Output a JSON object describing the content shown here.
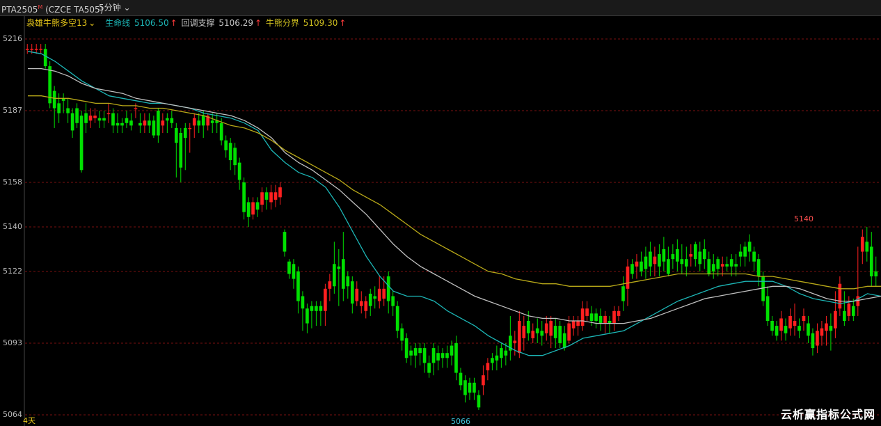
{
  "header": {
    "symbol": "PTA2505",
    "symbol_mark": "M",
    "code": "(CZCE TA505)",
    "period": "5分钟",
    "period_chevron": "chevron-down-icon"
  },
  "indicator": {
    "name": "袅雄牛熊多空13",
    "items": [
      {
        "label": "生命线",
        "value": "5106.50",
        "arrow": "↑",
        "color": "#1cb5b5"
      },
      {
        "label": "回调支撑",
        "value": "5106.29",
        "arrow": "↑",
        "color": "#c8c8c8"
      },
      {
        "label": "牛熊分界",
        "value": "5109.30",
        "arrow": "↑",
        "color": "#d0c020"
      }
    ]
  },
  "footer": {
    "days": "4天"
  },
  "watermark": "云析赢指标公式网",
  "colors": {
    "up": "#ff2020",
    "down": "#00e000",
    "grid": "#7a1010",
    "life": "#1cb5b5",
    "pull": "#c0c0c0",
    "split": "#b8a818"
  },
  "chart_data": {
    "type": "candlestick",
    "ylim": [
      5064,
      5216
    ],
    "y_ticks": [
      5216,
      5187,
      5158,
      5140,
      5122,
      5093,
      5064
    ],
    "annotations": [
      {
        "text": "5140",
        "value": 5140,
        "candle_index": 172,
        "color": "#ff5050"
      },
      {
        "text": "5066",
        "value": 5066,
        "candle_index": 96,
        "color": "#40c8e0"
      }
    ],
    "lines": [
      {
        "name": "生命线",
        "color": "#1cb5b5",
        "values": [
          5211,
          5210,
          5207,
          5203,
          5199,
          5196,
          5193,
          5192,
          5191,
          5190,
          5190,
          5189,
          5188,
          5186,
          5185,
          5184,
          5182,
          5179,
          5171,
          5166,
          5162,
          5160,
          5156,
          5148,
          5138,
          5128,
          5120,
          5114,
          5112,
          5112,
          5110,
          5106,
          5103,
          5100,
          5096,
          5093,
          5090,
          5088,
          5088,
          5090,
          5092,
          5095,
          5096,
          5097,
          5098,
          5101,
          5104,
          5107,
          5110,
          5112,
          5114,
          5116,
          5117,
          5118,
          5118,
          5118,
          5116,
          5113,
          5111,
          5110,
          5109,
          5110,
          5113,
          5112
        ]
      },
      {
        "name": "回调支撑",
        "color": "#c0c0c0",
        "values": [
          5204,
          5204,
          5203,
          5201,
          5198,
          5196,
          5195,
          5194,
          5192,
          5191,
          5190,
          5189,
          5188,
          5187,
          5186,
          5185,
          5183,
          5180,
          5176,
          5170,
          5166,
          5163,
          5159,
          5155,
          5150,
          5145,
          5139,
          5133,
          5128,
          5124,
          5121,
          5118,
          5115,
          5112,
          5110,
          5108,
          5106,
          5104,
          5103,
          5103,
          5102,
          5102,
          5101,
          5101,
          5101,
          5102,
          5103,
          5105,
          5107,
          5109,
          5111,
          5112,
          5113,
          5114,
          5115,
          5116,
          5116,
          5115,
          5113,
          5111,
          5110,
          5110,
          5111,
          5112
        ]
      },
      {
        "name": "牛熊分界",
        "color": "#b8a818",
        "values": [
          5193,
          5193,
          5192,
          5192,
          5191,
          5190,
          5190,
          5189,
          5189,
          5188,
          5188,
          5187,
          5186,
          5185,
          5183,
          5181,
          5180,
          5178,
          5175,
          5171,
          5168,
          5165,
          5162,
          5159,
          5155,
          5152,
          5149,
          5145,
          5141,
          5137,
          5134,
          5131,
          5128,
          5125,
          5122,
          5121,
          5119,
          5118,
          5117,
          5117,
          5116,
          5116,
          5116,
          5116,
          5117,
          5118,
          5119,
          5120,
          5121,
          5121,
          5121,
          5121,
          5121,
          5121,
          5120,
          5120,
          5119,
          5118,
          5117,
          5116,
          5115,
          5115,
          5116,
          5116
        ]
      }
    ],
    "candles": [
      [
        5212,
        5212,
        5210,
        5214
      ],
      [
        5212,
        5212,
        5210,
        5214
      ],
      [
        5212,
        5212,
        5210,
        5214
      ],
      [
        5212,
        5212,
        5210,
        5214
      ],
      [
        5212,
        5205,
        5204,
        5214
      ],
      [
        5205,
        5190,
        5188,
        5207
      ],
      [
        5195,
        5188,
        5180,
        5197
      ],
      [
        5190,
        5186,
        5182,
        5194
      ],
      [
        5192,
        5191,
        5186,
        5194
      ],
      [
        5188,
        5186,
        5182,
        5192
      ],
      [
        5186,
        5179,
        5176,
        5188
      ],
      [
        5188,
        5182,
        5180,
        5190
      ],
      [
        5185,
        5163,
        5162,
        5187
      ],
      [
        5186,
        5182,
        5178,
        5190
      ],
      [
        5183,
        5185,
        5180,
        5188
      ],
      [
        5184,
        5185,
        5182,
        5188
      ],
      [
        5184,
        5183,
        5180,
        5187
      ],
      [
        5184,
        5183,
        5180,
        5187
      ],
      [
        5186,
        5186,
        5182,
        5190
      ],
      [
        5186,
        5181,
        5178,
        5188
      ],
      [
        5182,
        5181,
        5178,
        5186
      ],
      [
        5182,
        5181,
        5178,
        5184
      ],
      [
        5184,
        5182,
        5180,
        5187
      ],
      [
        5183,
        5181,
        5179,
        5186
      ],
      [
        5188,
        5188,
        5184,
        5190
      ],
      [
        5182,
        5181,
        5178,
        5186
      ],
      [
        5181,
        5183,
        5178,
        5186
      ],
      [
        5183,
        5181,
        5178,
        5186
      ],
      [
        5183,
        5177,
        5176,
        5185
      ],
      [
        5187,
        5177,
        5174,
        5188
      ],
      [
        5181,
        5183,
        5178,
        5186
      ],
      [
        5184,
        5183,
        5178,
        5186
      ],
      [
        5184,
        5182,
        5180,
        5187
      ],
      [
        5180,
        5174,
        5160,
        5182
      ],
      [
        5178,
        5164,
        5158,
        5180
      ],
      [
        5180,
        5176,
        5163,
        5182
      ],
      [
        5180,
        5180,
        5170,
        5182
      ],
      [
        5181,
        5184,
        5176,
        5186
      ],
      [
        5183,
        5181,
        5178,
        5186
      ],
      [
        5185,
        5181,
        5176,
        5187
      ],
      [
        5181,
        5185,
        5179,
        5186
      ],
      [
        5183,
        5182,
        5178,
        5186
      ],
      [
        5183,
        5182,
        5178,
        5186
      ],
      [
        5182,
        5175,
        5173,
        5184
      ],
      [
        5175,
        5171,
        5168,
        5177
      ],
      [
        5174,
        5167,
        5163,
        5176
      ],
      [
        5172,
        5165,
        5161,
        5174
      ],
      [
        5166,
        5159,
        5155,
        5168
      ],
      [
        5158,
        5146,
        5143,
        5160
      ],
      [
        5150,
        5144,
        5140,
        5152
      ],
      [
        5145,
        5150,
        5143,
        5152
      ],
      [
        5150,
        5147,
        5144,
        5152
      ],
      [
        5149,
        5154,
        5146,
        5156
      ],
      [
        5154,
        5151,
        5147,
        5156
      ],
      [
        5150,
        5154,
        5147,
        5157
      ],
      [
        5151,
        5154,
        5148,
        5157
      ],
      [
        5152,
        5156,
        5149,
        5158
      ],
      [
        5138,
        5130,
        5128,
        5139
      ],
      [
        5126,
        5121,
        5119,
        5127
      ],
      [
        5125,
        5119,
        5115,
        5127
      ],
      [
        5122,
        5110,
        5105,
        5124
      ],
      [
        5112,
        5107,
        5098,
        5114
      ],
      [
        5107,
        5101,
        5097,
        5109
      ],
      [
        5108,
        5106,
        5099,
        5110
      ],
      [
        5108,
        5106,
        5100,
        5110
      ],
      [
        5108,
        5106,
        5100,
        5110
      ],
      [
        5106,
        5115,
        5100,
        5117
      ],
      [
        5115,
        5118,
        5110,
        5121
      ],
      [
        5125,
        5116,
        5113,
        5134
      ],
      [
        5124,
        5123,
        5108,
        5131
      ],
      [
        5127,
        5115,
        5110,
        5138
      ],
      [
        5120,
        5116,
        5111,
        5122
      ],
      [
        5118,
        5109,
        5105,
        5120
      ],
      [
        5110,
        5115,
        5108,
        5118
      ],
      [
        5108,
        5110,
        5105,
        5114
      ],
      [
        5106,
        5110,
        5103,
        5112
      ],
      [
        5113,
        5108,
        5104,
        5115
      ],
      [
        5112,
        5111,
        5107,
        5116
      ],
      [
        5110,
        5115,
        5107,
        5120
      ],
      [
        5111,
        5115,
        5108,
        5120
      ],
      [
        5120,
        5110,
        5105,
        5122
      ],
      [
        5112,
        5108,
        5104,
        5114
      ],
      [
        5108,
        5098,
        5095,
        5110
      ],
      [
        5099,
        5094,
        5090,
        5101
      ],
      [
        5095,
        5087,
        5085,
        5097
      ],
      [
        5090,
        5088,
        5084,
        5092
      ],
      [
        5091,
        5088,
        5083,
        5093
      ],
      [
        5091,
        5089,
        5084,
        5093
      ],
      [
        5091,
        5085,
        5081,
        5093
      ],
      [
        5085,
        5081,
        5079,
        5088
      ],
      [
        5091,
        5085,
        5080,
        5093
      ],
      [
        5089,
        5086,
        5082,
        5092
      ],
      [
        5089,
        5087,
        5083,
        5091
      ],
      [
        5089,
        5087,
        5083,
        5092
      ],
      [
        5092,
        5088,
        5084,
        5094
      ],
      [
        5093,
        5081,
        5078,
        5096
      ],
      [
        5081,
        5076,
        5074,
        5083
      ],
      [
        5078,
        5072,
        5069,
        5080
      ],
      [
        5077,
        5073,
        5070,
        5079
      ],
      [
        5077,
        5073,
        5070,
        5079
      ],
      [
        5072,
        5067,
        5066,
        5074
      ],
      [
        5076,
        5080,
        5072,
        5084
      ],
      [
        5082,
        5085,
        5078,
        5087
      ],
      [
        5087,
        5085,
        5082,
        5089
      ],
      [
        5088,
        5086,
        5082,
        5092
      ],
      [
        5091,
        5087,
        5083,
        5093
      ],
      [
        5090,
        5088,
        5084,
        5093
      ],
      [
        5096,
        5090,
        5086,
        5104
      ],
      [
        5093,
        5094,
        5088,
        5098
      ],
      [
        5089,
        5102,
        5087,
        5106
      ],
      [
        5095,
        5100,
        5090,
        5104
      ],
      [
        5102,
        5097,
        5094,
        5106
      ],
      [
        5095,
        5098,
        5093,
        5101
      ],
      [
        5099,
        5097,
        5093,
        5103
      ],
      [
        5098,
        5096,
        5092,
        5102
      ],
      [
        5097,
        5101,
        5094,
        5104
      ],
      [
        5096,
        5102,
        5091,
        5104
      ],
      [
        5100,
        5095,
        5091,
        5103
      ],
      [
        5100,
        5093,
        5091,
        5102
      ],
      [
        5097,
        5091,
        5090,
        5100
      ],
      [
        5094,
        5101,
        5093,
        5104
      ],
      [
        5099,
        5102,
        5096,
        5104
      ],
      [
        5100,
        5102,
        5096,
        5104
      ],
      [
        5100,
        5107,
        5098,
        5110
      ],
      [
        5104,
        5107,
        5102,
        5110
      ],
      [
        5105,
        5102,
        5100,
        5108
      ],
      [
        5105,
        5102,
        5099,
        5107
      ],
      [
        5104,
        5101,
        5098,
        5107
      ],
      [
        5101,
        5104,
        5097,
        5106
      ],
      [
        5102,
        5101,
        5097,
        5104
      ],
      [
        5101,
        5106,
        5098,
        5108
      ],
      [
        5104,
        5106,
        5102,
        5108
      ],
      [
        5116,
        5110,
        5106,
        5120
      ],
      [
        5115,
        5124,
        5108,
        5127
      ],
      [
        5125,
        5121,
        5119,
        5127
      ],
      [
        5124,
        5126,
        5119,
        5129
      ],
      [
        5126,
        5122,
        5120,
        5130
      ],
      [
        5128,
        5123,
        5119,
        5132
      ],
      [
        5130,
        5124,
        5120,
        5134
      ],
      [
        5125,
        5128,
        5120,
        5132
      ],
      [
        5129,
        5124,
        5120,
        5133
      ],
      [
        5131,
        5126,
        5122,
        5136
      ],
      [
        5127,
        5121,
        5120,
        5132
      ],
      [
        5129,
        5127,
        5123,
        5133
      ],
      [
        5131,
        5126,
        5122,
        5135
      ],
      [
        5127,
        5125,
        5121,
        5133
      ],
      [
        5127,
        5124,
        5120,
        5132
      ],
      [
        5128,
        5129,
        5124,
        5133
      ],
      [
        5133,
        5127,
        5124,
        5134
      ],
      [
        5130,
        5125,
        5122,
        5134
      ],
      [
        5131,
        5127,
        5123,
        5135
      ],
      [
        5127,
        5121,
        5120,
        5130
      ],
      [
        5125,
        5122,
        5119,
        5129
      ],
      [
        5127,
        5123,
        5120,
        5128
      ],
      [
        5124,
        5125,
        5120,
        5128
      ],
      [
        5125,
        5124,
        5122,
        5128
      ],
      [
        5127,
        5124,
        5120,
        5129
      ],
      [
        5125,
        5124,
        5120,
        5129
      ],
      [
        5130,
        5128,
        5124,
        5133
      ],
      [
        5132,
        5128,
        5124,
        5134
      ],
      [
        5134,
        5130,
        5126,
        5137
      ],
      [
        5130,
        5126,
        5122,
        5132
      ],
      [
        5127,
        5120,
        5116,
        5129
      ],
      [
        5120,
        5110,
        5108,
        5122
      ],
      [
        5112,
        5102,
        5100,
        5116
      ],
      [
        5102,
        5098,
        5096,
        5104
      ],
      [
        5100,
        5096,
        5094,
        5102
      ],
      [
        5098,
        5103,
        5094,
        5106
      ],
      [
        5100,
        5097,
        5094,
        5103
      ],
      [
        5099,
        5104,
        5096,
        5107
      ],
      [
        5100,
        5102,
        5096,
        5109
      ],
      [
        5100,
        5098,
        5095,
        5103
      ],
      [
        5102,
        5104,
        5098,
        5107
      ],
      [
        5101,
        5096,
        5093,
        5104
      ],
      [
        5097,
        5091,
        5088,
        5099
      ],
      [
        5092,
        5098,
        5089,
        5101
      ],
      [
        5096,
        5099,
        5092,
        5102
      ],
      [
        5098,
        5101,
        5092,
        5104
      ],
      [
        5100,
        5098,
        5090,
        5105
      ],
      [
        5099,
        5106,
        5095,
        5114
      ],
      [
        5107,
        5117,
        5104,
        5120
      ],
      [
        5106,
        5102,
        5100,
        5114
      ],
      [
        5104,
        5109,
        5102,
        5112
      ],
      [
        5108,
        5104,
        5102,
        5111
      ],
      [
        5108,
        5112,
        5104,
        5132
      ],
      [
        5130,
        5136,
        5125,
        5139
      ],
      [
        5134,
        5130,
        5126,
        5140
      ],
      [
        5132,
        5120,
        5116,
        5138
      ],
      [
        5122,
        5120,
        5116,
        5128
      ]
    ]
  }
}
